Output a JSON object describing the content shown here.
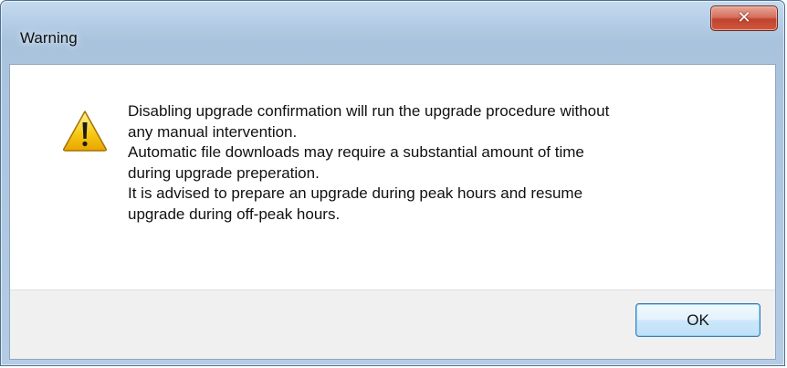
{
  "window": {
    "title": "Warning",
    "close_icon": "close-icon",
    "close_glyph": "✕"
  },
  "message": {
    "icon": "warning-icon",
    "lines": [
      "Disabling upgrade confirmation will run the upgrade procedure without",
      "any manual intervention.",
      "Automatic file downloads may require a substantial amount of time",
      "during upgrade preperation.",
      "It is advised to prepare an upgrade during peak hours and resume",
      "upgrade during off-peak hours."
    ]
  },
  "buttons": {
    "ok_label": "OK"
  },
  "colors": {
    "frame": "#b7cfe7",
    "close_button": "#c9503a",
    "warning_fill": "#f5c400",
    "ok_button": "#cce7fa"
  }
}
